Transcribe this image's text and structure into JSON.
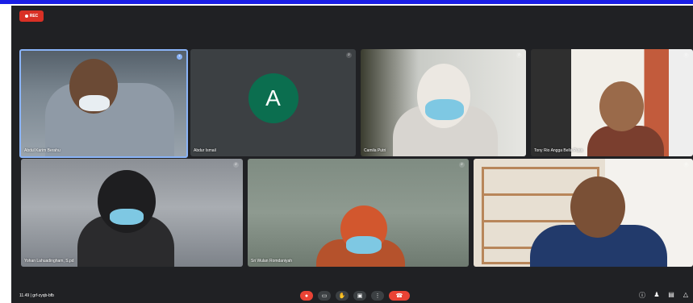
{
  "recording_badge": "REC",
  "participants": [
    {
      "name": "Abdul Karim Berahu",
      "avatar_letter": ""
    },
    {
      "name": "Abdur Ismail",
      "avatar_letter": "A"
    },
    {
      "name": "Camila Putri",
      "avatar_letter": ""
    },
    {
      "name": "Tony Rio Angga Bella Pusa",
      "avatar_letter": ""
    },
    {
      "name": "Yohan Lahuadingham, S.pd",
      "avatar_letter": ""
    },
    {
      "name": "Sri Wulan Romdaniyah",
      "avatar_letter": ""
    },
    {
      "name": "",
      "avatar_letter": ""
    }
  ],
  "meeting": {
    "time": "11.49",
    "separator": "|",
    "code": "grf-zyqb-bfb"
  },
  "controls": {
    "mic_icon": "microphone-off-icon",
    "camera_icon": "camera-icon",
    "hand_icon": "raise-hand-icon",
    "present_icon": "present-screen-icon",
    "more_icon": "more-options-icon",
    "end_icon": "end-call-icon"
  },
  "colors": {
    "accent": "#1a1ee6",
    "stage": "#202124",
    "end_call": "#ea4335",
    "avatar_bg": "#0b6e4f"
  }
}
